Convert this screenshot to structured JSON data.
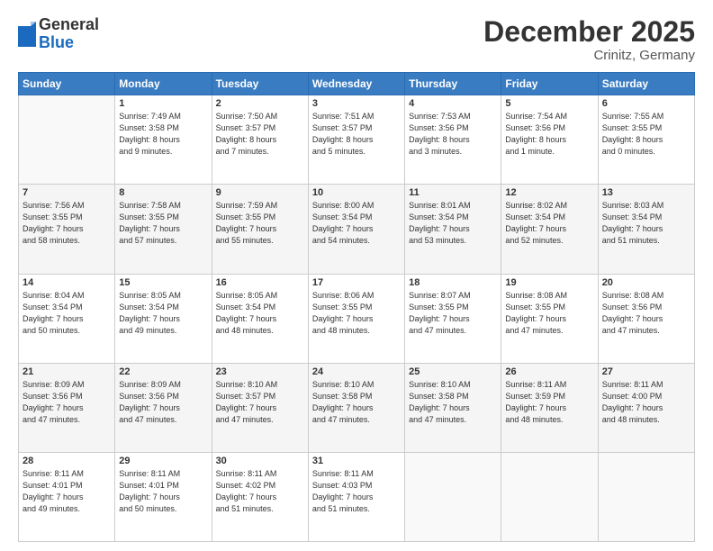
{
  "header": {
    "logo_line1": "General",
    "logo_line2": "Blue",
    "month": "December 2025",
    "location": "Crinitz, Germany"
  },
  "weekdays": [
    "Sunday",
    "Monday",
    "Tuesday",
    "Wednesday",
    "Thursday",
    "Friday",
    "Saturday"
  ],
  "weeks": [
    [
      {
        "day": "",
        "info": ""
      },
      {
        "day": "1",
        "info": "Sunrise: 7:49 AM\nSunset: 3:58 PM\nDaylight: 8 hours\nand 9 minutes."
      },
      {
        "day": "2",
        "info": "Sunrise: 7:50 AM\nSunset: 3:57 PM\nDaylight: 8 hours\nand 7 minutes."
      },
      {
        "day": "3",
        "info": "Sunrise: 7:51 AM\nSunset: 3:57 PM\nDaylight: 8 hours\nand 5 minutes."
      },
      {
        "day": "4",
        "info": "Sunrise: 7:53 AM\nSunset: 3:56 PM\nDaylight: 8 hours\nand 3 minutes."
      },
      {
        "day": "5",
        "info": "Sunrise: 7:54 AM\nSunset: 3:56 PM\nDaylight: 8 hours\nand 1 minute."
      },
      {
        "day": "6",
        "info": "Sunrise: 7:55 AM\nSunset: 3:55 PM\nDaylight: 8 hours\nand 0 minutes."
      }
    ],
    [
      {
        "day": "7",
        "info": "Sunrise: 7:56 AM\nSunset: 3:55 PM\nDaylight: 7 hours\nand 58 minutes."
      },
      {
        "day": "8",
        "info": "Sunrise: 7:58 AM\nSunset: 3:55 PM\nDaylight: 7 hours\nand 57 minutes."
      },
      {
        "day": "9",
        "info": "Sunrise: 7:59 AM\nSunset: 3:55 PM\nDaylight: 7 hours\nand 55 minutes."
      },
      {
        "day": "10",
        "info": "Sunrise: 8:00 AM\nSunset: 3:54 PM\nDaylight: 7 hours\nand 54 minutes."
      },
      {
        "day": "11",
        "info": "Sunrise: 8:01 AM\nSunset: 3:54 PM\nDaylight: 7 hours\nand 53 minutes."
      },
      {
        "day": "12",
        "info": "Sunrise: 8:02 AM\nSunset: 3:54 PM\nDaylight: 7 hours\nand 52 minutes."
      },
      {
        "day": "13",
        "info": "Sunrise: 8:03 AM\nSunset: 3:54 PM\nDaylight: 7 hours\nand 51 minutes."
      }
    ],
    [
      {
        "day": "14",
        "info": "Sunrise: 8:04 AM\nSunset: 3:54 PM\nDaylight: 7 hours\nand 50 minutes."
      },
      {
        "day": "15",
        "info": "Sunrise: 8:05 AM\nSunset: 3:54 PM\nDaylight: 7 hours\nand 49 minutes."
      },
      {
        "day": "16",
        "info": "Sunrise: 8:05 AM\nSunset: 3:54 PM\nDaylight: 7 hours\nand 48 minutes."
      },
      {
        "day": "17",
        "info": "Sunrise: 8:06 AM\nSunset: 3:55 PM\nDaylight: 7 hours\nand 48 minutes."
      },
      {
        "day": "18",
        "info": "Sunrise: 8:07 AM\nSunset: 3:55 PM\nDaylight: 7 hours\nand 47 minutes."
      },
      {
        "day": "19",
        "info": "Sunrise: 8:08 AM\nSunset: 3:55 PM\nDaylight: 7 hours\nand 47 minutes."
      },
      {
        "day": "20",
        "info": "Sunrise: 8:08 AM\nSunset: 3:56 PM\nDaylight: 7 hours\nand 47 minutes."
      }
    ],
    [
      {
        "day": "21",
        "info": "Sunrise: 8:09 AM\nSunset: 3:56 PM\nDaylight: 7 hours\nand 47 minutes."
      },
      {
        "day": "22",
        "info": "Sunrise: 8:09 AM\nSunset: 3:56 PM\nDaylight: 7 hours\nand 47 minutes."
      },
      {
        "day": "23",
        "info": "Sunrise: 8:10 AM\nSunset: 3:57 PM\nDaylight: 7 hours\nand 47 minutes."
      },
      {
        "day": "24",
        "info": "Sunrise: 8:10 AM\nSunset: 3:58 PM\nDaylight: 7 hours\nand 47 minutes."
      },
      {
        "day": "25",
        "info": "Sunrise: 8:10 AM\nSunset: 3:58 PM\nDaylight: 7 hours\nand 47 minutes."
      },
      {
        "day": "26",
        "info": "Sunrise: 8:11 AM\nSunset: 3:59 PM\nDaylight: 7 hours\nand 48 minutes."
      },
      {
        "day": "27",
        "info": "Sunrise: 8:11 AM\nSunset: 4:00 PM\nDaylight: 7 hours\nand 48 minutes."
      }
    ],
    [
      {
        "day": "28",
        "info": "Sunrise: 8:11 AM\nSunset: 4:01 PM\nDaylight: 7 hours\nand 49 minutes."
      },
      {
        "day": "29",
        "info": "Sunrise: 8:11 AM\nSunset: 4:01 PM\nDaylight: 7 hours\nand 50 minutes."
      },
      {
        "day": "30",
        "info": "Sunrise: 8:11 AM\nSunset: 4:02 PM\nDaylight: 7 hours\nand 51 minutes."
      },
      {
        "day": "31",
        "info": "Sunrise: 8:11 AM\nSunset: 4:03 PM\nDaylight: 7 hours\nand 51 minutes."
      },
      {
        "day": "",
        "info": ""
      },
      {
        "day": "",
        "info": ""
      },
      {
        "day": "",
        "info": ""
      }
    ]
  ]
}
